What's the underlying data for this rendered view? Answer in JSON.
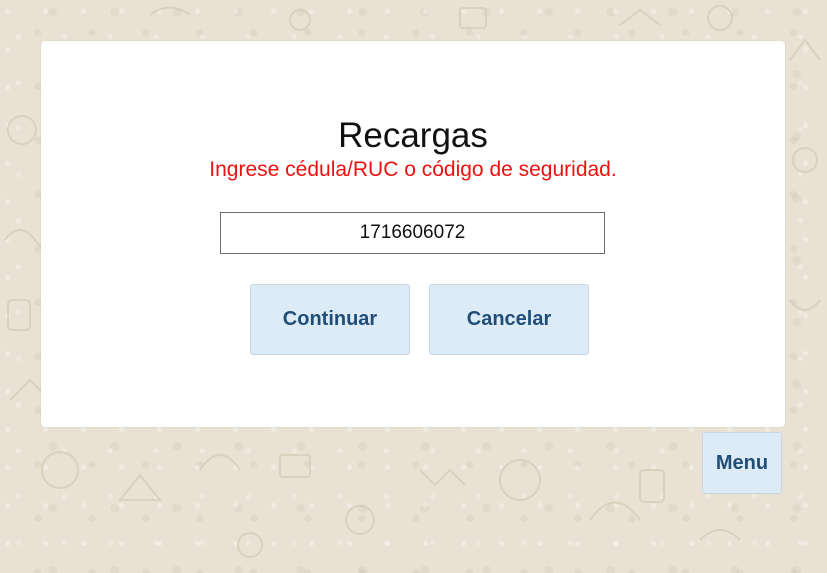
{
  "dialog": {
    "title": "Recargas",
    "message": "Ingrese cédula/RUC o código de seguridad.",
    "id_value": "1716606072",
    "continue_label": "Continuar",
    "cancel_label": "Cancelar"
  },
  "menu_label": "Menu",
  "colors": {
    "message": "#ee1111",
    "button_bg": "#ddebf7",
    "button_text": "#1f4e79",
    "background": "#e9e2d4"
  }
}
